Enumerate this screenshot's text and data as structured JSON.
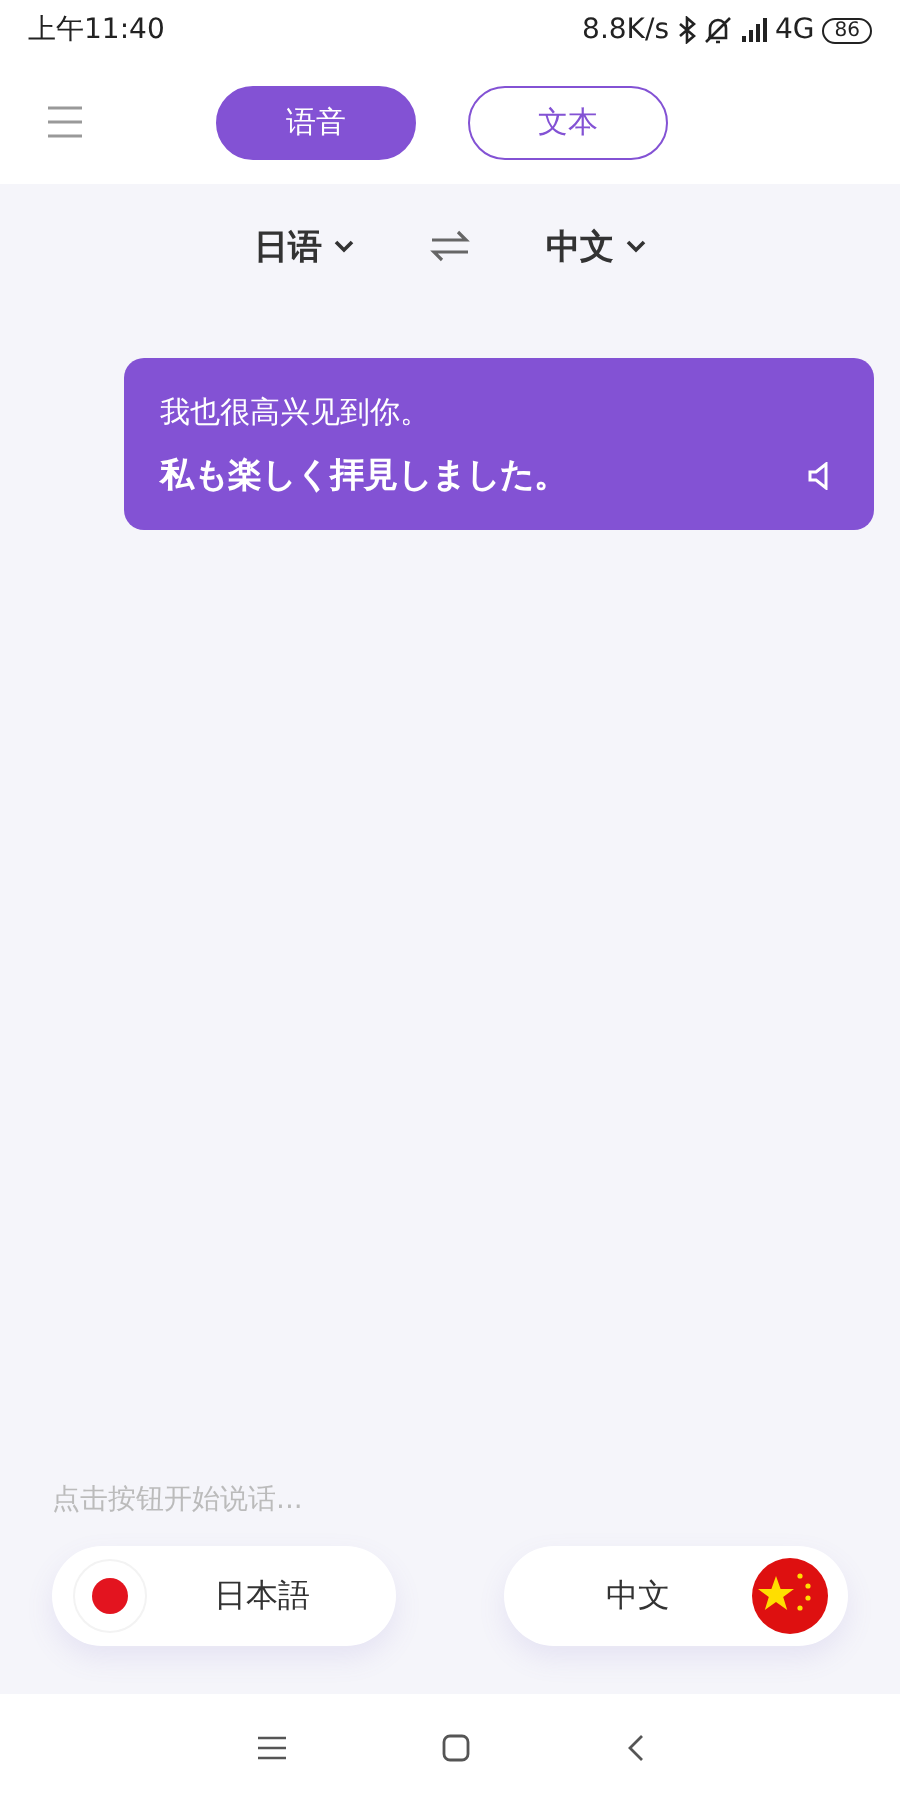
{
  "status_bar": {
    "time": "上午11:40",
    "speed": "8.8K/s",
    "network": "4G",
    "battery": "86"
  },
  "tabs": [
    {
      "label": "语音",
      "selected": true
    },
    {
      "label": "文本",
      "selected": false
    }
  ],
  "languages": {
    "source": "日语",
    "target": "中文"
  },
  "messages": [
    {
      "translation": "我也很高兴见到你。",
      "original": "私も楽しく拝見しました。"
    }
  ],
  "hint": "点击按钮开始说话...",
  "speakers": [
    {
      "kind": "japan",
      "label": "日本語"
    },
    {
      "kind": "china",
      "label": "中文"
    }
  ]
}
